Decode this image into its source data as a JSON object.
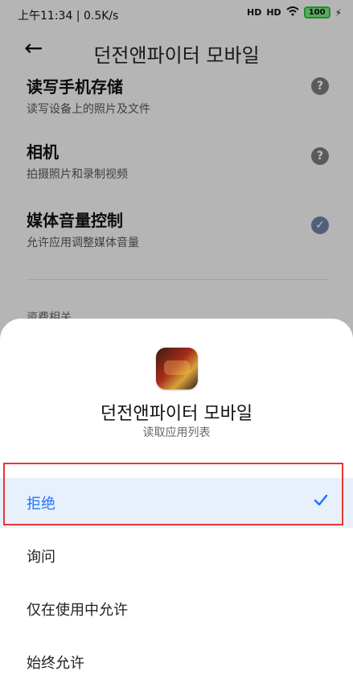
{
  "status_bar": {
    "time_speed": "上午11:34 | 0.5K/s",
    "signal1": "HD",
    "signal2": "HD",
    "battery": "100"
  },
  "header": {
    "title": "던전앤파이터 모바일"
  },
  "permissions": [
    {
      "title": "读写手机存储",
      "desc": "读写设备上的照片及文件"
    },
    {
      "title": "相机",
      "desc": "拍摄照片和录制视频"
    },
    {
      "title": "媒体音量控制",
      "desc": "允许应用调整媒体音量"
    }
  ],
  "section_label": "资费相关",
  "sheet": {
    "app_name": "던전앤파이터 모바일",
    "subtitle": "读取应用列表",
    "options": [
      {
        "label": "拒绝",
        "selected": true
      },
      {
        "label": "询问"
      },
      {
        "label": "仅在使用中允许"
      },
      {
        "label": "始终允许"
      }
    ]
  },
  "colors": {
    "accent": "#1f74ff",
    "selected_bg": "#e8f0fb",
    "highlight_box": "#e53935"
  }
}
